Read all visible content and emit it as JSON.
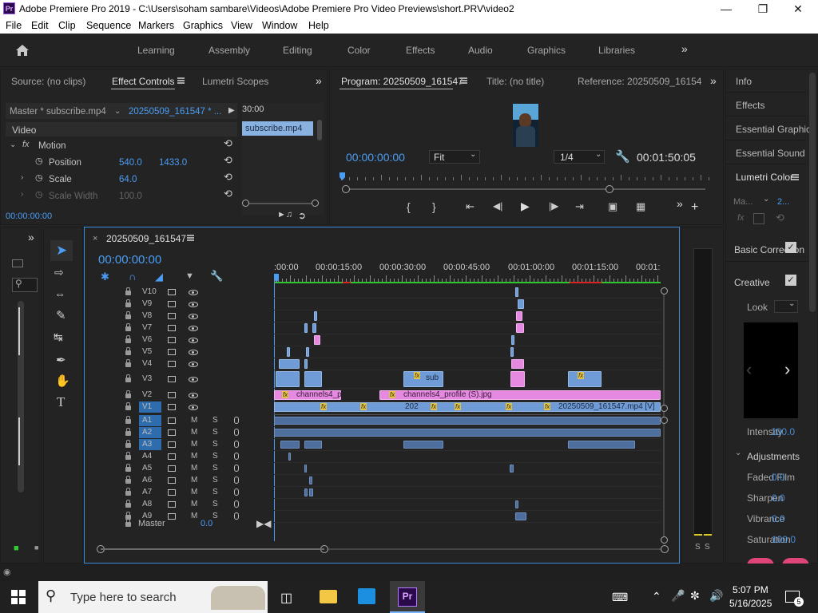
{
  "window": {
    "title": "Adobe Premiere Pro 2019 - C:\\Users\\soham sambare\\Videos\\Adobe Premiere Pro Video Previews\\short.PRV\\video2",
    "app_icon": "Pr"
  },
  "menu": [
    "File",
    "Edit",
    "Clip",
    "Sequence",
    "Markers",
    "Graphics",
    "View",
    "Window",
    "Help"
  ],
  "workspaces": [
    "Learning",
    "Assembly",
    "Editing",
    "Color",
    "Effects",
    "Audio",
    "Graphics",
    "Libraries"
  ],
  "source_panel": {
    "tabs": [
      "Source: (no clips)",
      "Effect Controls",
      "Lumetri Scopes"
    ],
    "master_label": "Master * subscribe.mp4",
    "sequence_label": "20250509_161547 * ...",
    "timecode_ruler": "30:00",
    "clip_name": "subscribe.mp4",
    "video_header": "Video",
    "motion_label": "Motion",
    "position_label": "Position",
    "position_x": "540.0",
    "position_y": "1433.0",
    "scale_label": "Scale",
    "scale_value": "64.0",
    "scale_width_label": "Scale Width",
    "scale_width_value": "100.0",
    "timecode": "00:00:00:00"
  },
  "program_panel": {
    "tab": "Program: 20250509_161547",
    "title_tab": "Title: (no title)",
    "reference_tab": "Reference: 20250509_16154",
    "timecode": "00:00:00:00",
    "fit": "Fit",
    "resolution": "1/4",
    "duration": "00:01:50:05",
    "playhead_fraction": 0.0
  },
  "right_panel": {
    "items": [
      "Info",
      "Effects",
      "Essential Graphic",
      "Essential Sound",
      "Lumetri Color"
    ],
    "master_label": "Ma...",
    "clip_short": "2...",
    "basic_correction": "Basic Correction",
    "creative": "Creative",
    "look": "Look",
    "intensity": "Intensity",
    "intensity_value": "100.0",
    "adjustments": "Adjustments",
    "faded_film": "Faded Film",
    "faded_film_value": "0.0",
    "sharpen": "Sharpen",
    "sharpen_value": "0.0",
    "vibrance": "Vibrance",
    "vibrance_value": "0.0",
    "saturation": "Saturation",
    "saturation_value": "100.0"
  },
  "timeline": {
    "sequence_tab": "20250509_161547",
    "timecode": "00:00:00:00",
    "ruler_labels": [
      ":00:00",
      "00:00:15:00",
      "00:00:30:00",
      "00:00:45:00",
      "00:01:00:00",
      "00:01:15:00",
      "00:01:"
    ],
    "video_tracks": [
      "V10",
      "V9",
      "V8",
      "V7",
      "V6",
      "V5",
      "V4",
      "V3",
      "V2",
      "V1"
    ],
    "audio_tracks": [
      "A1",
      "A2",
      "A3",
      "A4",
      "A5",
      "A6",
      "A7",
      "A8",
      "A9"
    ],
    "source_v": "V1",
    "source_a": [
      "A1",
      "A2",
      "A3"
    ],
    "mute_label": "M",
    "solo_label": "S",
    "master_label": "Master",
    "master_value": "0.0",
    "clips": {
      "v3_sub": "sub",
      "v2_a": "channels4_p",
      "v2_b": "channels4_profile (S).jpg",
      "v1_mid": "202",
      "v1_main": "20250509_161547.mp4 [V]"
    },
    "fx": "fx"
  },
  "audio_meter": {
    "labels": [
      "S",
      "S"
    ]
  },
  "taskbar": {
    "search_placeholder": "Type here to search",
    "time": "5:07 PM",
    "date": "5/16/2025",
    "notification_count": "5"
  }
}
